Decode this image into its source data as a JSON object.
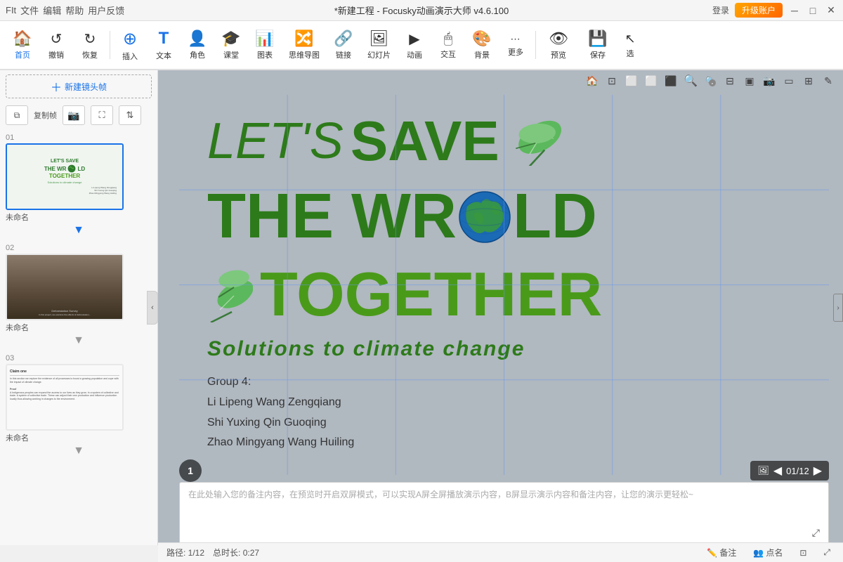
{
  "titlebar": {
    "menu_items": [
      "FIt",
      "文件",
      "编辑",
      "帮助",
      "用户反馈"
    ],
    "title": "*新建工程 - Focusky动画演示大师  v4.6.100",
    "login": "登录",
    "upgrade": "升级账户",
    "win_min": "─",
    "win_max": "□",
    "win_close": "✕"
  },
  "toolbar": {
    "items": [
      {
        "id": "home",
        "icon": "🏠",
        "label": "首页"
      },
      {
        "id": "undo",
        "icon": "↺",
        "label": "撤销"
      },
      {
        "id": "redo",
        "icon": "↻",
        "label": "恢复"
      },
      {
        "id": "insert",
        "icon": "⊞",
        "label": "插入"
      },
      {
        "id": "text",
        "icon": "T",
        "label": "文本"
      },
      {
        "id": "role",
        "icon": "👤",
        "label": "角色"
      },
      {
        "id": "class",
        "icon": "🎓",
        "label": "课堂"
      },
      {
        "id": "chart",
        "icon": "📊",
        "label": "图表"
      },
      {
        "id": "mindmap",
        "icon": "🔀",
        "label": "思维导图"
      },
      {
        "id": "link",
        "icon": "🔗",
        "label": "链接"
      },
      {
        "id": "slide",
        "icon": "🖼",
        "label": "幻灯片"
      },
      {
        "id": "anim",
        "icon": "▶",
        "label": "动画"
      },
      {
        "id": "interact",
        "icon": "🖱",
        "label": "交互"
      },
      {
        "id": "bg",
        "icon": "🎨",
        "label": "背景"
      },
      {
        "id": "more",
        "icon": "⋯",
        "label": "更多"
      },
      {
        "id": "preview",
        "icon": "👁",
        "label": "预览"
      },
      {
        "id": "save",
        "icon": "💾",
        "label": "保存"
      },
      {
        "id": "select",
        "icon": "↖",
        "label": "选"
      }
    ]
  },
  "left_panel": {
    "new_shot_label": "新建镜头帧",
    "action_btns": [
      "复制帧",
      "📷",
      "⛶",
      "↕"
    ],
    "slides": [
      {
        "num": "01",
        "name": "未命名",
        "type": "green_world"
      },
      {
        "num": "02",
        "name": "未命名",
        "type": "forest"
      },
      {
        "num": "03",
        "name": "未命名",
        "type": "text"
      }
    ]
  },
  "canvas": {
    "tools": [
      "🏠",
      "🔲",
      "⬜",
      "⬜",
      "⬜",
      "🔍+",
      "🔍-",
      "⊟",
      "▣",
      "📷",
      "▭",
      "⊞",
      "✎"
    ],
    "slide_content": {
      "line1_lets": "LET'S",
      "line1_save": "SAVE",
      "line2_the": "THE WR",
      "line2_ld": "LD",
      "line3_together": "TOGETHER",
      "solutions": "Solutions to climate change",
      "group": "Group 4:",
      "members": [
        "Li Lipeng      Wang Zengqiang",
        "Shi Yuxing    Qin Guoqing",
        "Zhao Mingyang   Wang Huiling"
      ]
    },
    "slide_num": "1",
    "nav": {
      "prev": "◀",
      "current": "01/12",
      "next": "▶",
      "icon": "🖼"
    }
  },
  "notes": {
    "placeholder": "在此处输入您的备注内容，在预览时开启双屏模式，可以实现A屏全屏播放演示内容，B屏显示演示内容和备注内容，让您的演示更轻松~"
  },
  "statusbar": {
    "path": "路径: 1/12",
    "duration": "总时长: 0:27",
    "annotation": "备注",
    "points": "点名",
    "fit_icon": "⊡",
    "expand_icon": "⤢"
  }
}
